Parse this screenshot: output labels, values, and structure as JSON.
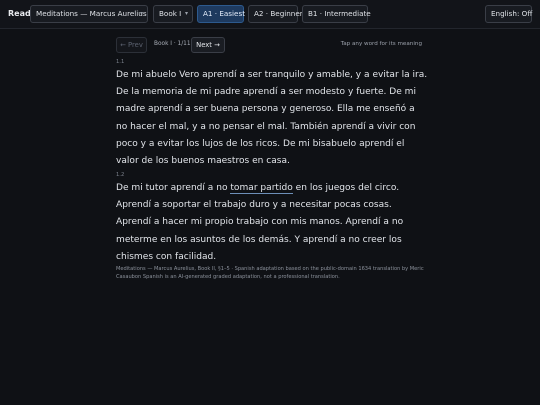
{
  "header": {
    "app_label": "Read",
    "book_select": "Meditations — Marcus Aurelius",
    "chapter_select": "Book I",
    "levels": [
      "A1 · Easiest",
      "A2 · Beginner",
      "B1 · Intermediate"
    ],
    "active_level": "A1 · Easiest",
    "english_toggle": "English: Off",
    "chevron": "▾"
  },
  "nav": {
    "prev_label": "← Prev",
    "position": "Book I · 1/11",
    "next_label": "Next →",
    "hint": "Tap any word for its meaning"
  },
  "paragraphs": [
    {
      "label": "1.1",
      "lines": [
        "De mi abuelo Vero aprendí a ser tranquilo y amable, y a evitar la ira.",
        "De la memoria de mi padre aprendí a ser modesto y fuerte. De mi",
        "madre aprendí a ser buena persona y generoso. Ella me enseñó a",
        "no hacer el mal, y a no pensar el mal. También aprendí a vivir con",
        "poco y a evitar los lujos de los ricos. De mi bisabuelo aprendí el",
        "valor de los buenos maestros en casa."
      ]
    },
    {
      "label": "1.2",
      "line1_before": "De mi tutor aprendí a no ",
      "line1_highlight": "tomar partido",
      "line1_after": " en los juegos del circo.",
      "lines": [
        "Aprendí a soportar el trabajo duro y a necesitar pocas cosas.",
        "Aprendí a hacer mi propio trabajo con mis manos. Aprendí a no",
        "meterme en los asuntos de los demás. Y aprendí a no creer los",
        "chismes con facilidad."
      ]
    }
  ],
  "credit": {
    "lines": [
      "Meditations — Marcus Aurelius, Book II, §1–5 · Spanish adaptation based on the public-domain 1634 translation by Meric",
      "Casaubon Spanish is an AI-generated graded adaptation, not a professional translation."
    ]
  }
}
